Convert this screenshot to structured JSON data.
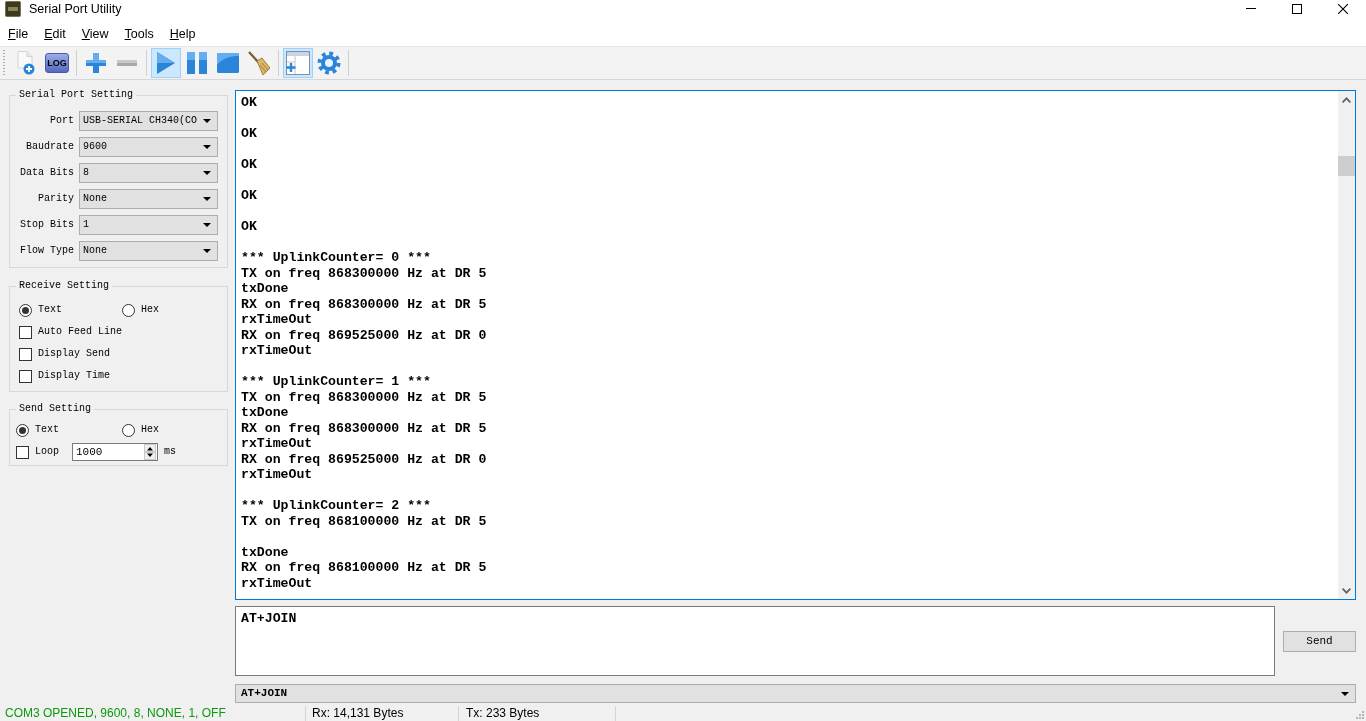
{
  "window": {
    "title": "Serial Port Utility"
  },
  "menu": [
    "File",
    "Edit",
    "View",
    "Tools",
    "Help"
  ],
  "toolbar": [
    {
      "buttons": [
        {
          "kind": "newfile",
          "pressed": false,
          "disabled": false
        },
        {
          "kind": "log",
          "label": "LOG",
          "pressed": false,
          "disabled": false
        }
      ]
    },
    {
      "buttons": [
        {
          "kind": "add",
          "pressed": false,
          "disabled": false
        },
        {
          "kind": "remove",
          "pressed": false,
          "disabled": true
        }
      ]
    },
    {
      "buttons": [
        {
          "kind": "play",
          "pressed": true,
          "disabled": false
        },
        {
          "kind": "pause",
          "pressed": false,
          "disabled": false
        },
        {
          "kind": "stop",
          "pressed": false,
          "disabled": false
        },
        {
          "kind": "broom",
          "pressed": false,
          "disabled": false
        }
      ]
    },
    {
      "buttons": [
        {
          "kind": "panel",
          "pressed": true,
          "disabled": false
        },
        {
          "kind": "gear",
          "pressed": false,
          "disabled": false
        }
      ]
    }
  ],
  "serial_port_setting": {
    "title": "Serial Port Setting",
    "fields": [
      {
        "label": "Port",
        "value": "USB-SERIAL CH340(CO"
      },
      {
        "label": "Baudrate",
        "value": "9600"
      },
      {
        "label": "Data Bits",
        "value": "8"
      },
      {
        "label": "Parity",
        "value": "None"
      },
      {
        "label": "Stop Bits",
        "value": "1"
      },
      {
        "label": "Flow Type",
        "value": "None"
      }
    ]
  },
  "receive_setting": {
    "title": "Receive Setting",
    "format": [
      {
        "label": "Text",
        "selected": true
      },
      {
        "label": "Hex",
        "selected": false
      }
    ],
    "options": [
      {
        "label": "Auto Feed Line",
        "checked": false
      },
      {
        "label": "Display Send",
        "checked": false
      },
      {
        "label": "Display Time",
        "checked": false
      }
    ]
  },
  "send_setting": {
    "title": "Send Setting",
    "format": [
      {
        "label": "Text",
        "selected": true
      },
      {
        "label": "Hex",
        "selected": false
      }
    ],
    "loop": {
      "label": "Loop",
      "checked": false,
      "interval": "1000",
      "unit": "ms"
    }
  },
  "receive_log": {
    "blocks": [
      [
        "OK"
      ],
      [
        "OK"
      ],
      [
        "OK"
      ],
      [
        "OK"
      ],
      [
        "OK"
      ],
      [
        "*** UplinkCounter= 0 ***",
        "TX on freq 868300000 Hz at DR 5",
        "txDone",
        "RX on freq 868300000 Hz at DR 5",
        "rxTimeOut",
        "RX on freq 869525000 Hz at DR 0",
        "rxTimeOut"
      ],
      [
        "*** UplinkCounter= 1 ***",
        "TX on freq 868300000 Hz at DR 5",
        "txDone",
        "RX on freq 868300000 Hz at DR 5",
        "rxTimeOut",
        "RX on freq 869525000 Hz at DR 0",
        "rxTimeOut"
      ],
      [
        "*** UplinkCounter= 2 ***",
        "TX on freq 868100000 Hz at DR 5"
      ],
      [
        "txDone",
        "RX on freq 868100000 Hz at DR 5",
        "rxTimeOut"
      ]
    ]
  },
  "send_input": {
    "value": "AT+JOIN"
  },
  "send_button": "Send",
  "history": {
    "value": "AT+JOIN"
  },
  "status_bar": {
    "connection": "COM3 OPENED, 9600, 8, NONE, 1, OFF",
    "rx": "Rx: 14,131 Bytes",
    "tx": "Tx: 233 Bytes"
  }
}
